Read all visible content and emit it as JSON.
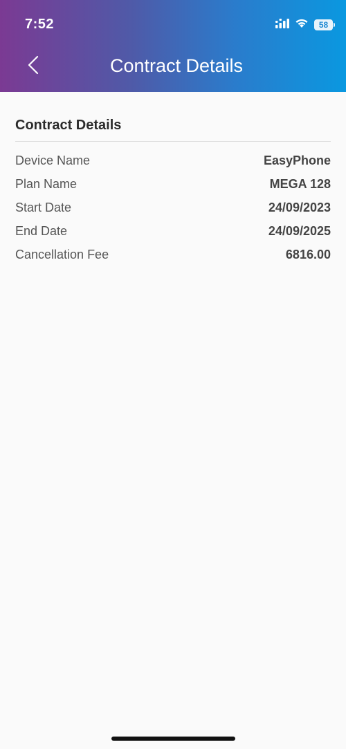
{
  "status_bar": {
    "time": "7:52",
    "battery_level": "58",
    "icons": [
      "signal-icon",
      "wifi-icon",
      "battery-icon"
    ]
  },
  "header": {
    "title": "Contract Details",
    "back_icon": "chevron-left-icon",
    "gradient_colors": [
      "#7b3a93",
      "#4f5aa8",
      "#0a98e0"
    ]
  },
  "contract": {
    "section_title": "Contract Details",
    "rows": [
      {
        "label": "Device Name",
        "value": "EasyPhone"
      },
      {
        "label": "Plan Name",
        "value": "MEGA 128"
      },
      {
        "label": "Start Date",
        "value": "24/09/2023"
      },
      {
        "label": "End Date",
        "value": "24/09/2025"
      },
      {
        "label": "Cancellation Fee",
        "value": "6816.00"
      }
    ]
  }
}
